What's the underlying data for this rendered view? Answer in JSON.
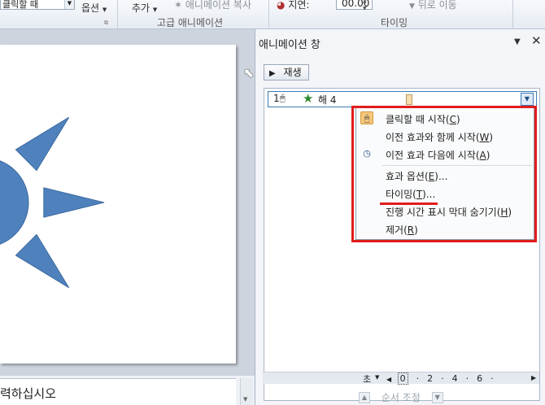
{
  "ribbon": {
    "cut_combo_value": "클릭할 때",
    "options_label": "옵션",
    "add_label": "추가",
    "painter_label": "애니메이션 복사",
    "advanced_group_label": "고급 애니메이션",
    "delay_label": "지연:",
    "delay_value": "00.00",
    "move_later_label": "뒤로 이동",
    "timing_group_label": "타이밍"
  },
  "slide": {
    "notes_text": "력하십시오",
    "sun_color": "#4f81bd"
  },
  "animation_pane": {
    "title": "애니메이션 창",
    "play_label": "재생",
    "item": {
      "number": "1",
      "name": "해 4"
    },
    "menu": [
      {
        "label": "클릭할 때 시작",
        "hotkey": "C",
        "icon": "mouse-icon"
      },
      {
        "label": "이전 효과와 함께 시작",
        "hotkey": "W",
        "icon": ""
      },
      {
        "label": "이전 효과 다음에 시작",
        "hotkey": "A",
        "icon": "clock-icon"
      },
      {
        "label": "효과 옵션",
        "hotkey": "E",
        "suffix": "...",
        "icon": ""
      },
      {
        "label": "타이밍",
        "hotkey": "T",
        "suffix": "...",
        "icon": ""
      },
      {
        "label": "진행 시간 표시 막대 숨기기",
        "hotkey": "H",
        "icon": ""
      },
      {
        "label": "제거",
        "hotkey": "R",
        "icon": ""
      }
    ],
    "timeline": {
      "units": "초",
      "ticks": [
        "0",
        "2",
        "4",
        "6"
      ]
    },
    "reorder_label": "순서 조정",
    "highlight_color": "#e11c1c"
  }
}
